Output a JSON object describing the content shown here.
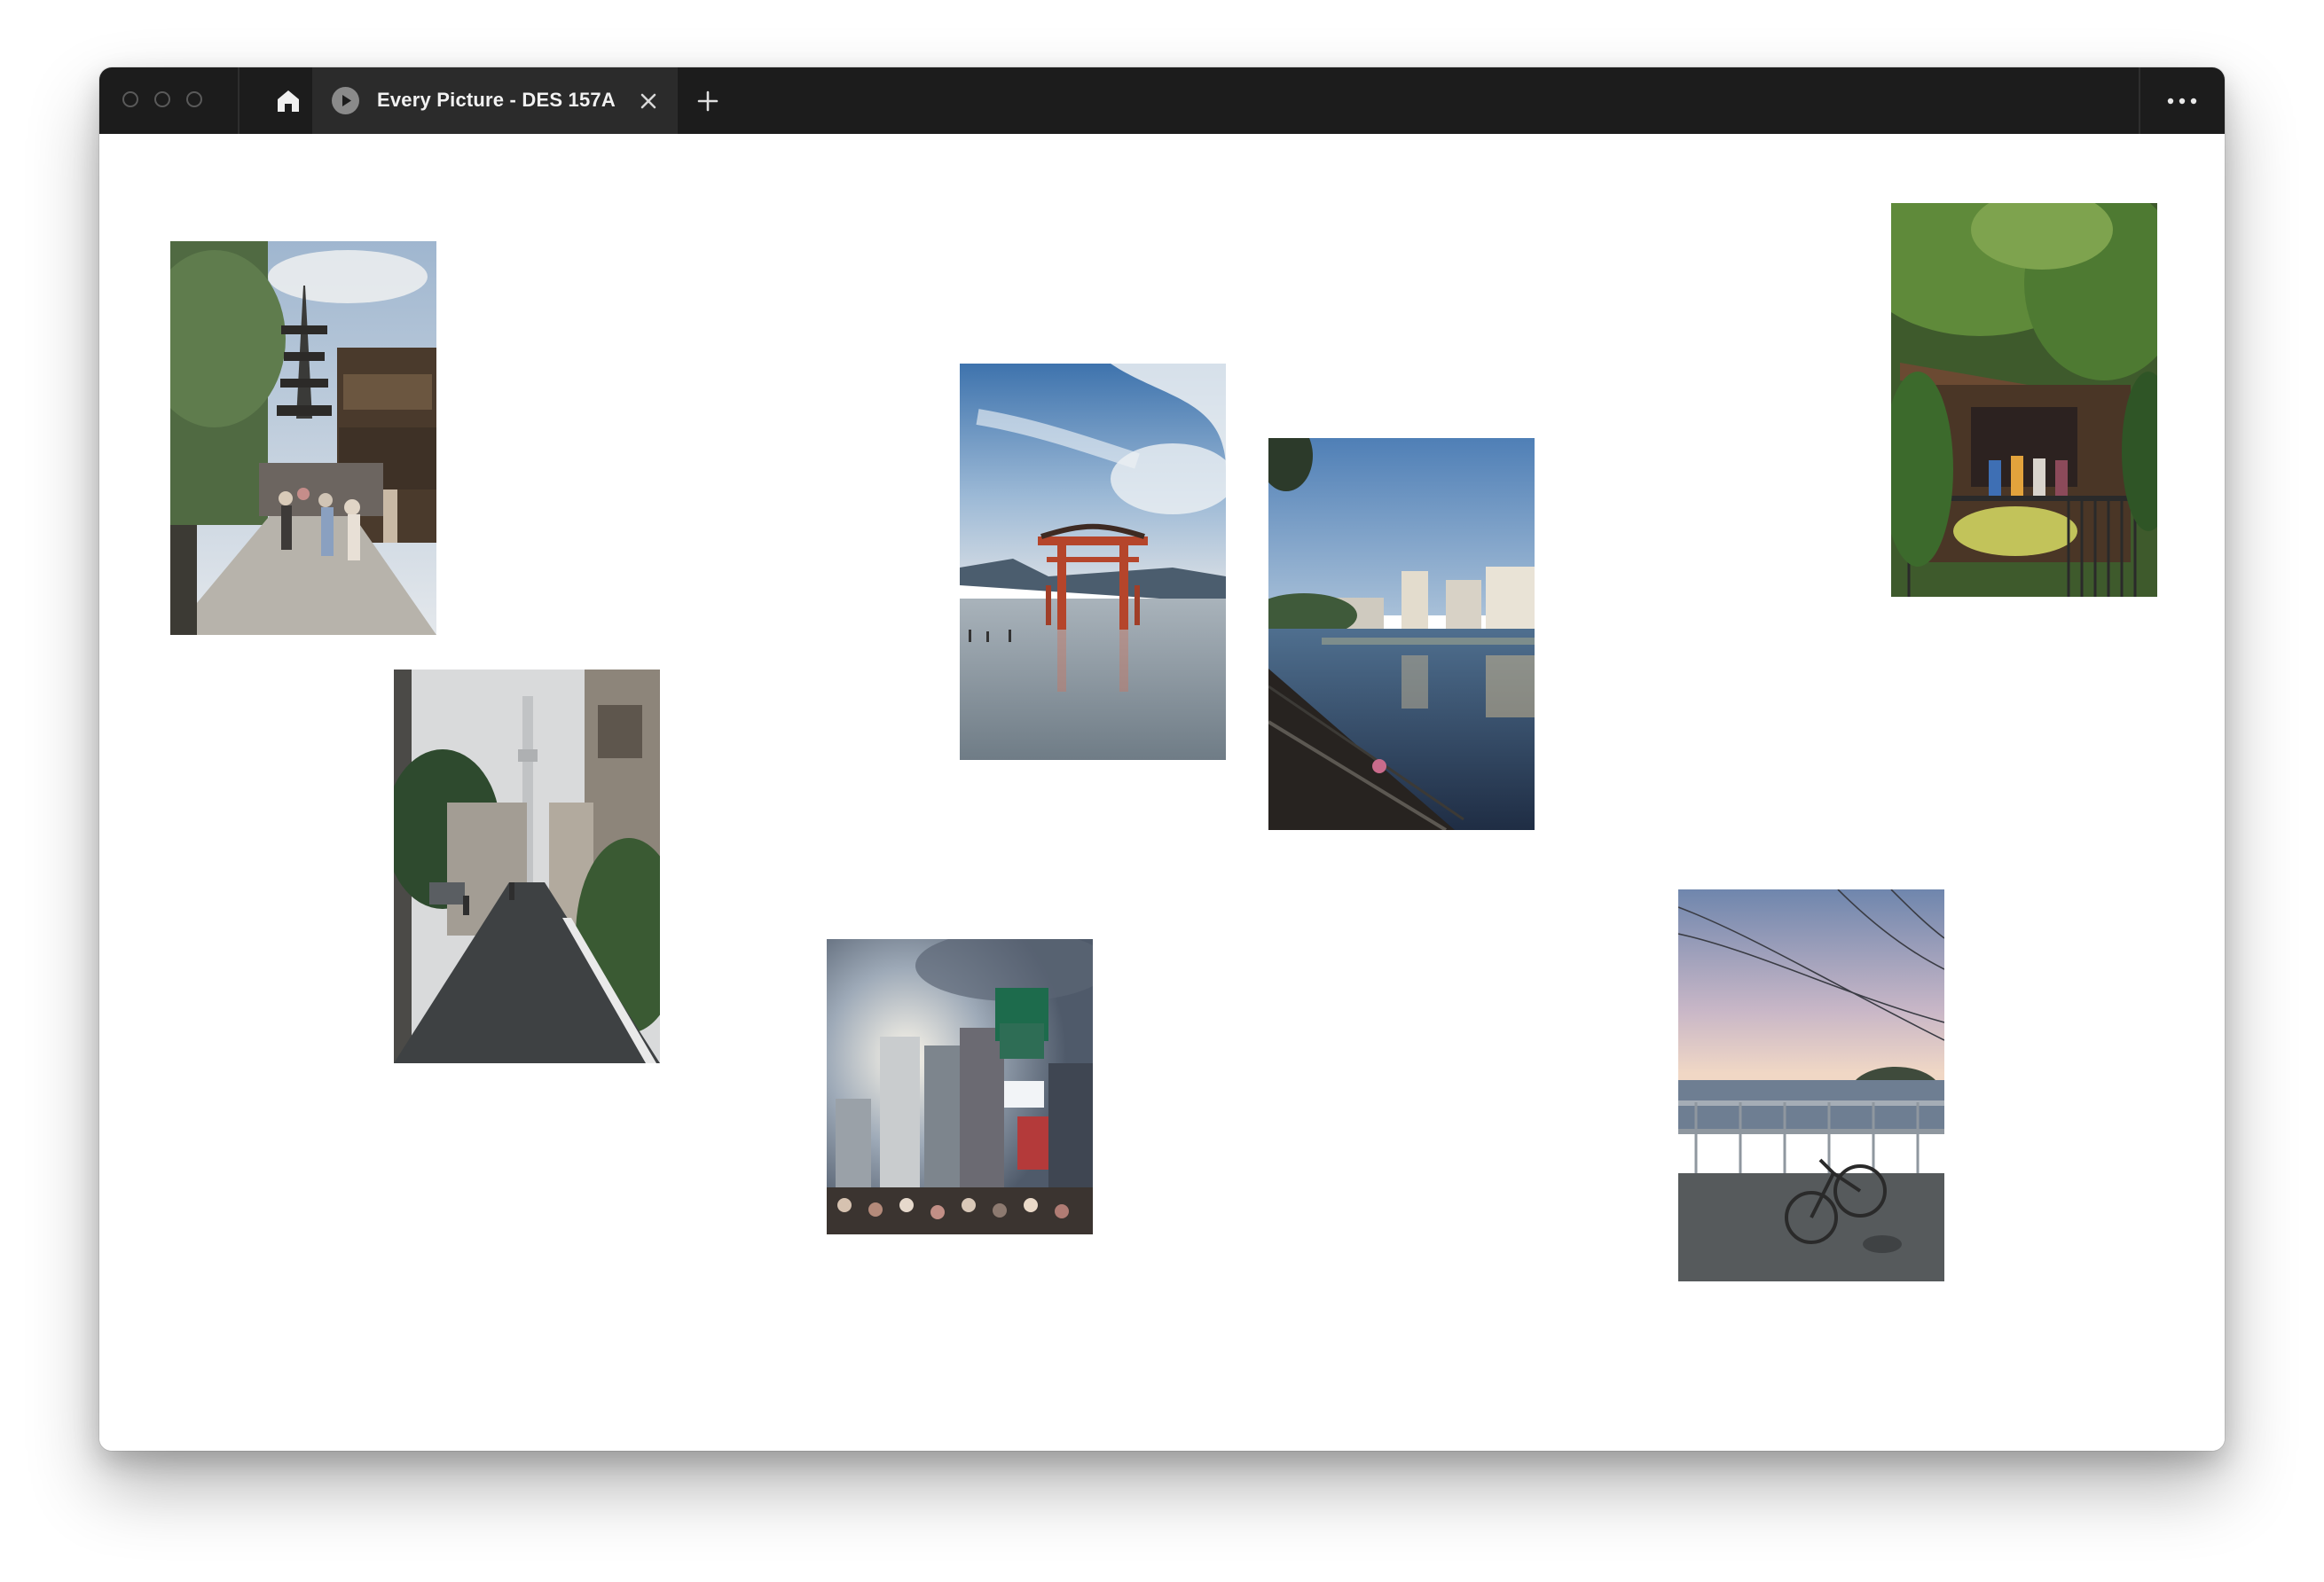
{
  "tab": {
    "title": "Every Picture - DES 157A"
  },
  "icons": {
    "home": "home-icon",
    "play": "play-icon",
    "close": "close-icon",
    "new_tab": "plus-icon",
    "more": "more-icon"
  },
  "colors": {
    "titlebar": "#1c1c1c",
    "active_tab": "#2b2b2b",
    "canvas": "#ffffff"
  },
  "photos": [
    "kyoto-pagoda-street",
    "tokyo-skytree-street",
    "miyajima-torii-gate",
    "river-city-view",
    "shibuya-crossing",
    "house-under-trees",
    "seaside-bicycle-sunset"
  ]
}
